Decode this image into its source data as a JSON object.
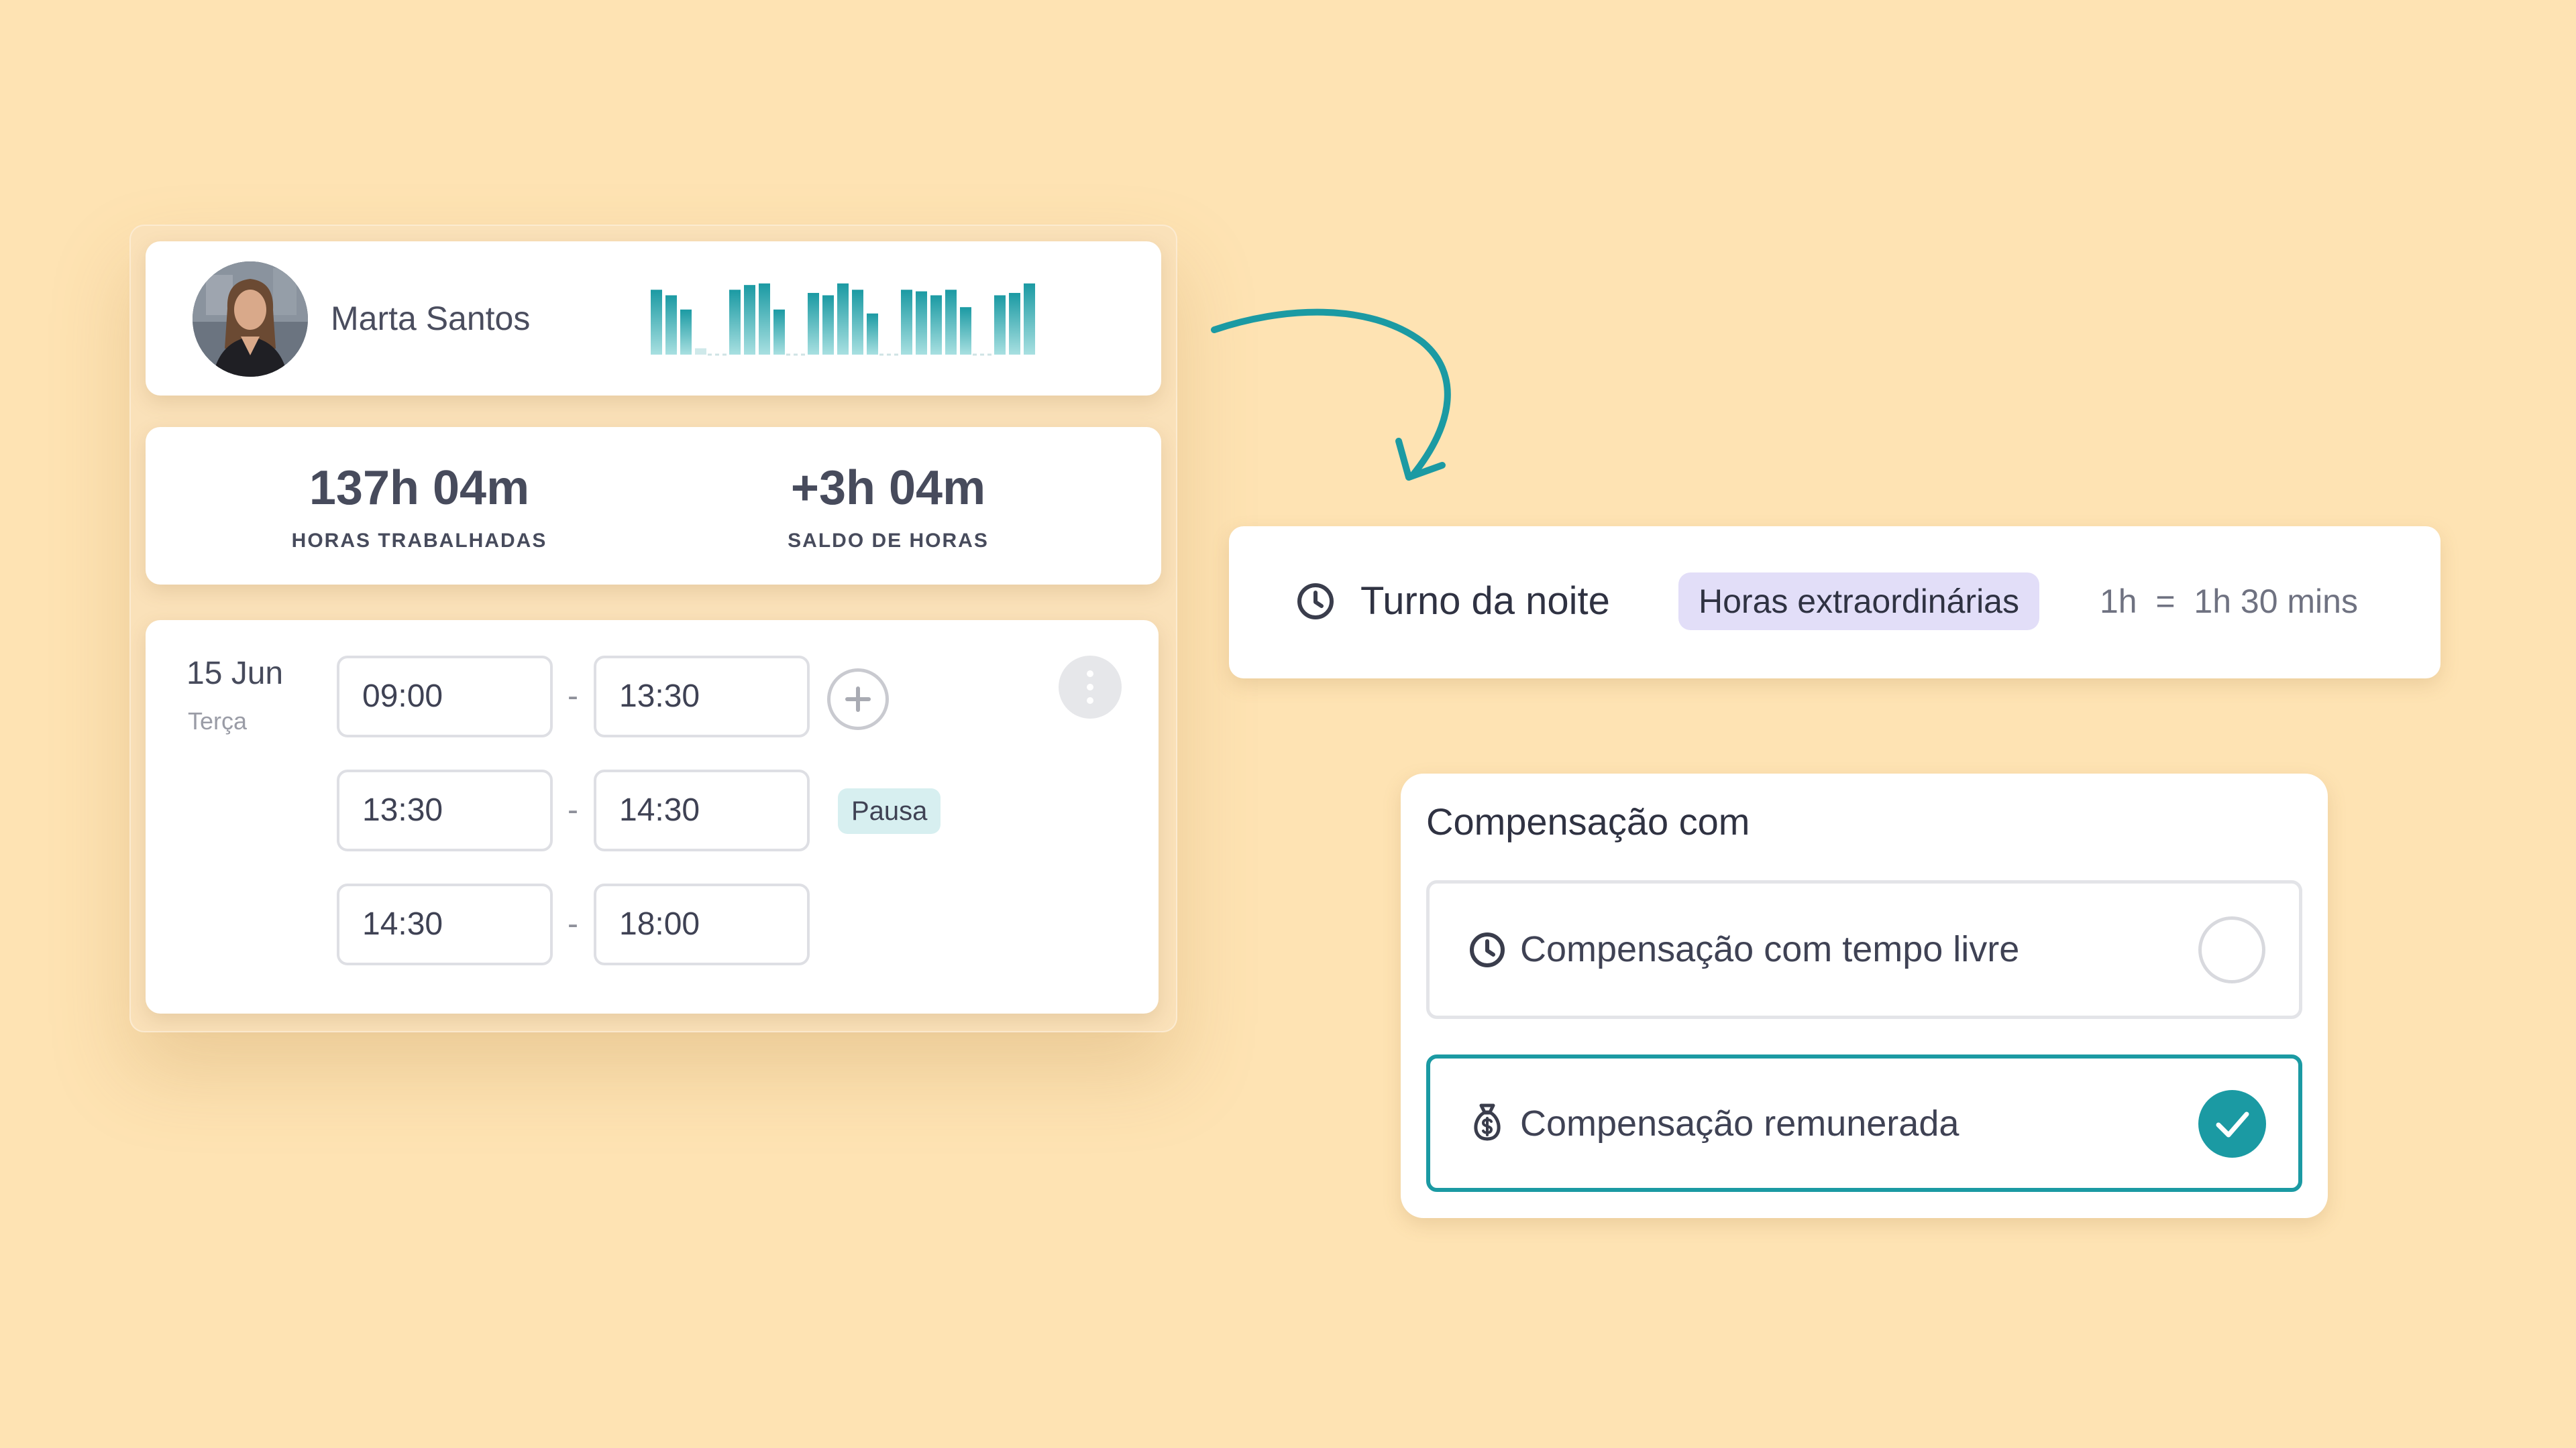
{
  "colors": {
    "background": "#FEE3B3",
    "accent": "#1B9AA3",
    "badge_extra": "#E2DEF8",
    "badge_pause": "#D7EFF0"
  },
  "profile": {
    "name": "Marta Santos",
    "avatar_icon": "user-photo"
  },
  "activity_chart": {
    "type": "bar",
    "groups": [
      [
        0.82,
        0.75,
        0.57,
        0.08
      ],
      [
        0.82,
        0.88,
        0.9,
        0.57
      ],
      [
        0.78,
        0.75,
        0.9,
        0.82,
        0.52
      ],
      [
        0.82,
        0.8,
        0.75,
        0.82,
        0.6
      ],
      [
        0.75,
        0.78,
        0.9
      ]
    ]
  },
  "stats": {
    "worked_value": "137h 04m",
    "worked_label": "HORAS TRABALHADAS",
    "balance_value": "+3h 04m",
    "balance_label": "SALDO DE HORAS"
  },
  "day_entry": {
    "date": "15 Jun",
    "weekday": "Terça",
    "rows": [
      {
        "start": "09:00",
        "end": "13:30",
        "separator": "-"
      },
      {
        "start": "13:30",
        "end": "14:30",
        "separator": "-",
        "tag": "Pausa"
      },
      {
        "start": "14:30",
        "end": "18:00",
        "separator": "-"
      }
    ],
    "add_icon": "plus-icon",
    "more_icon": "more-vertical-icon"
  },
  "shift_rule": {
    "icon": "clock-icon",
    "title": "Turno da noite",
    "badge": "Horas extraordinárias",
    "ratio": "1h  =  1h 30 mins"
  },
  "compensation": {
    "title": "Compensação com",
    "options": [
      {
        "icon": "clock-icon",
        "label": "Compensação com tempo livre",
        "selected": false
      },
      {
        "icon": "money-bag-icon",
        "label": "Compensação remunerada",
        "selected": true
      }
    ]
  }
}
